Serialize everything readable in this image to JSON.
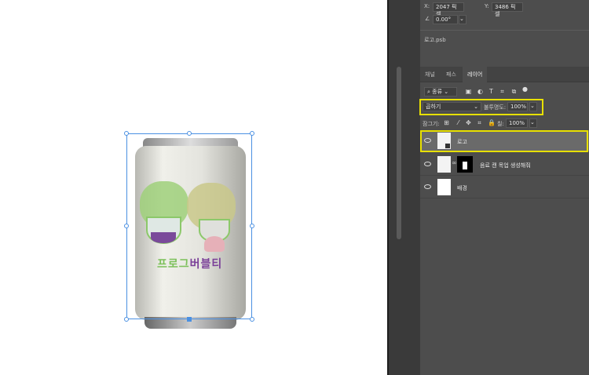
{
  "properties": {
    "x_label": "X:",
    "x_value": "2047 픽셀",
    "y_label": "Y:",
    "y_value": "3486 픽셀",
    "angle_value": "0.00°",
    "linked_file": "로고.psb"
  },
  "tabs": [
    {
      "label": "채널"
    },
    {
      "label": "패스"
    },
    {
      "label": "레이어"
    }
  ],
  "layers_panel": {
    "filter_label": "종류",
    "blend_mode": "곱하기",
    "opacity_label": "불투명도:",
    "opacity_value": "100%",
    "lock_label": "잠그기:",
    "fill_label": "칠:",
    "fill_value": "100%"
  },
  "layers": [
    {
      "name": "로고",
      "selected": true
    },
    {
      "name": "음료 캔 목업 생성해줘",
      "selected": false
    },
    {
      "name": "배경",
      "selected": false
    }
  ],
  "artwork": {
    "logo_text_green": "프로그",
    "logo_text_purple": "버블티"
  },
  "colors": {
    "highlight": "#e8e000",
    "selection": "#4a90e2",
    "logo_green": "#7cc05a",
    "logo_purple": "#7a3f98"
  }
}
